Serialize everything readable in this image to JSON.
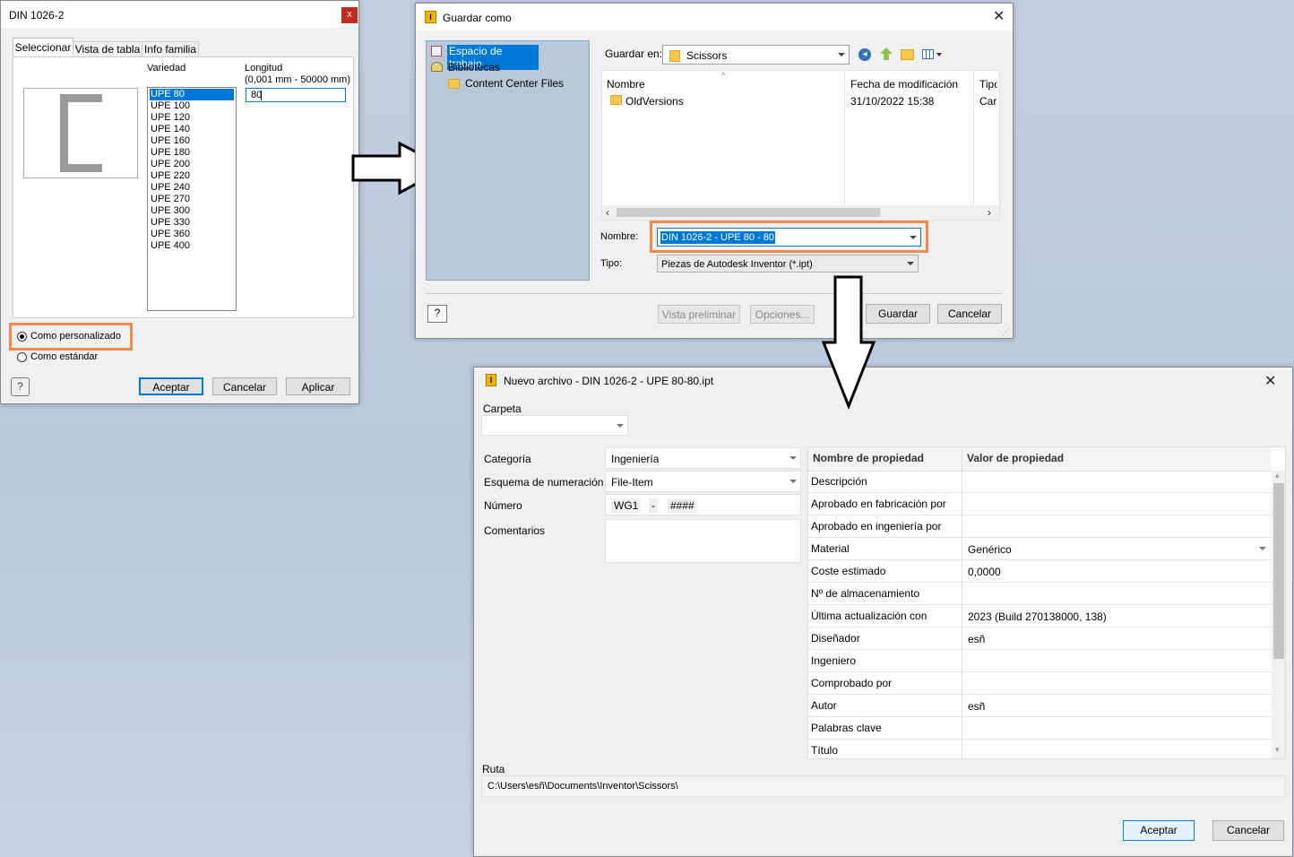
{
  "din_dialog": {
    "title": "DIN 1026-2",
    "close": "x",
    "tabs": [
      "Seleccionar",
      "Vista de tabla",
      "Info familia"
    ],
    "variedad_label": "Variedad",
    "longitud_label": "Longitud",
    "longitud_range": "(0,001 mm - 50000 mm)",
    "longitud_value": "80",
    "variedades": [
      "UPE 80",
      "UPE 100",
      "UPE 120",
      "UPE 140",
      "UPE 160",
      "UPE 180",
      "UPE 200",
      "UPE 220",
      "UPE 240",
      "UPE 270",
      "UPE 300",
      "UPE 330",
      "UPE 360",
      "UPE 400"
    ],
    "selected_variedad": "UPE 80",
    "radio_custom": "Como personalizado",
    "radio_standard": "Como estándar",
    "btn_ok": "Aceptar",
    "btn_cancel": "Cancelar",
    "btn_apply": "Aplicar"
  },
  "save_dialog": {
    "title": "Guardar como",
    "places": [
      "Espacio de trabajo",
      "Bibliotecas",
      "Content Center Files"
    ],
    "save_in_label": "Guardar en:",
    "save_in_value": "Scissors",
    "columns": [
      "Nombre",
      "Fecha de modificación",
      "Tipo"
    ],
    "files": [
      {
        "name": "OldVersions",
        "date": "31/10/2022 15:38",
        "type": "Carp"
      }
    ],
    "name_label": "Nombre:",
    "name_value": "DIN 1026-2 - UPE 80 - 80",
    "type_label": "Tipo:",
    "type_value": "Piezas de Autodesk Inventor (*.ipt)",
    "btn_preview": "Vista preliminar",
    "btn_options": "Opciones...",
    "btn_save": "Guardar",
    "btn_cancel": "Cancelar"
  },
  "new_file_dialog": {
    "title": "Nuevo archivo - DIN 1026-2 - UPE 80-80.ipt",
    "carpeta_label": "Carpeta",
    "categoria_label": "Categoría",
    "categoria_value": "Ingeniería",
    "esquema_label": "Esquema de numeración",
    "esquema_value": "File-Item",
    "numero_label": "Número",
    "numero_prefix": "WG1",
    "numero_dash": "-",
    "numero_mask": "####",
    "comentarios_label": "Comentarios",
    "prop_header_name": "Nombre de propiedad",
    "prop_header_value": "Valor de propiedad",
    "properties": [
      {
        "name": "Descripción",
        "value": ""
      },
      {
        "name": "Aprobado en fabricación por",
        "value": ""
      },
      {
        "name": "Aprobado en ingeniería por",
        "value": ""
      },
      {
        "name": "Material",
        "value": "Genérico"
      },
      {
        "name": "Coste estimado",
        "value": "0,0000"
      },
      {
        "name": "Nº de almacenamiento",
        "value": ""
      },
      {
        "name": "Última actualización con",
        "value": "2023 (Build 270138000, 138)"
      },
      {
        "name": "Diseñador",
        "value": "esñ"
      },
      {
        "name": "Ingeniero",
        "value": ""
      },
      {
        "name": "Comprobado por",
        "value": ""
      },
      {
        "name": "Autor",
        "value": "esñ"
      },
      {
        "name": "Palabras clave",
        "value": ""
      },
      {
        "name": "Título",
        "value": ""
      }
    ],
    "ruta_label": "Ruta",
    "ruta_value": "C:\\Users\\esñ\\Documents\\Inventor\\Scissors\\",
    "btn_ok": "Aceptar",
    "btn_cancel": "Cancelar"
  }
}
